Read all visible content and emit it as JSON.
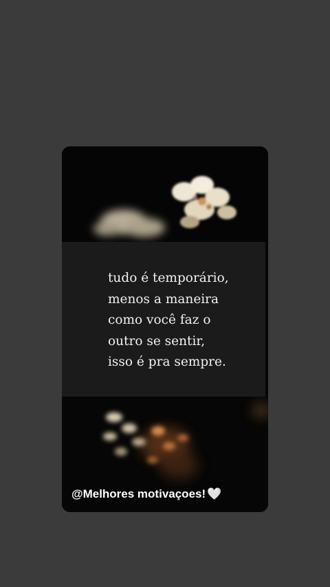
{
  "story": {
    "quote_lines": [
      "tudo é temporário,",
      "menos a maneira",
      "como você faz o",
      "outro se sentir,",
      "isso é pra sempre."
    ],
    "handle": "@Melhores motivaçoes!",
    "handle_emoji": "🤍",
    "colors": {
      "page_background": "#3b3b3c",
      "card_background": "#060606",
      "quote_panel": "#1b1b1c",
      "text": "#f2f2f2"
    }
  }
}
